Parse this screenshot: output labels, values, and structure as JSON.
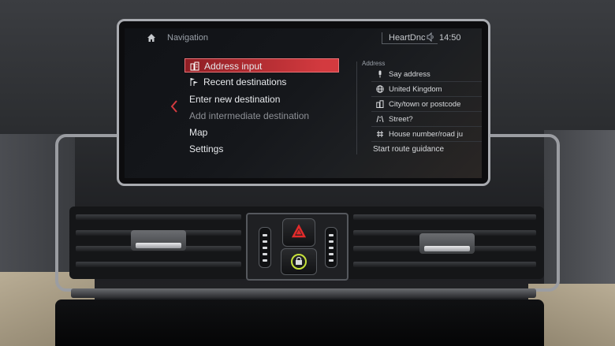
{
  "header": {
    "title": "Navigation",
    "audio_source": "HeartDnc",
    "time": "14:50"
  },
  "menu": {
    "items": [
      {
        "label": "Address input",
        "selected": true,
        "icon": "address-book-icon"
      },
      {
        "label": "Recent destinations",
        "selected": false,
        "icon": "recent-flags-icon"
      },
      {
        "label": "Enter new destination",
        "selected": false
      },
      {
        "label": "Add intermediate destination",
        "selected": false,
        "disabled": true
      },
      {
        "label": "Map",
        "selected": false
      },
      {
        "label": "Settings",
        "selected": false
      }
    ]
  },
  "address_panel": {
    "title": "Address",
    "items": [
      {
        "label": "Say address",
        "icon": "microphone-icon"
      },
      {
        "label": "United Kingdom",
        "icon": "globe-icon"
      },
      {
        "label": "City/town or postcode",
        "icon": "city-icon"
      },
      {
        "label": "Street?",
        "icon": "road-icon"
      },
      {
        "label": "House number/road ju",
        "icon": "house-number-icon"
      },
      {
        "label": "Start route guidance"
      }
    ]
  },
  "colors": {
    "selection": "#d33a3f",
    "text": "#e7e9ec",
    "muted": "#8d9096",
    "hazard_red": "#e32b2b",
    "lock_green": "#c7e23a"
  }
}
